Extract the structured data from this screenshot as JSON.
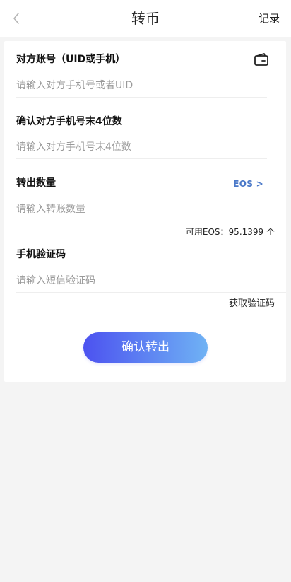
{
  "header": {
    "title": "转币",
    "records_label": "记录"
  },
  "form": {
    "account": {
      "label": "对方账号（UID或手机）",
      "placeholder": "请输入对方手机号或者UID",
      "value": ""
    },
    "phone_confirm": {
      "label": "确认对方手机号末4位数",
      "placeholder": "请输入对方手机号末4位数",
      "value": ""
    },
    "amount": {
      "label": "转出数量",
      "placeholder": "请输入转账数量",
      "value": "",
      "currency_label": "EOS >",
      "available_text": "可用EOS：95.1399 个"
    },
    "sms_code": {
      "label": "手机验证码",
      "placeholder": "请输入短信验证码",
      "value": "",
      "get_code_label": "获取验证码"
    },
    "submit_label": "确认转出"
  },
  "colors": {
    "accent_start": "#4c52f0",
    "accent_end": "#6fb2f4",
    "link": "#4a78c8",
    "background": "#f4f4f4"
  },
  "icons": {
    "back": "chevron-left-icon",
    "wallet": "wallet-icon"
  }
}
